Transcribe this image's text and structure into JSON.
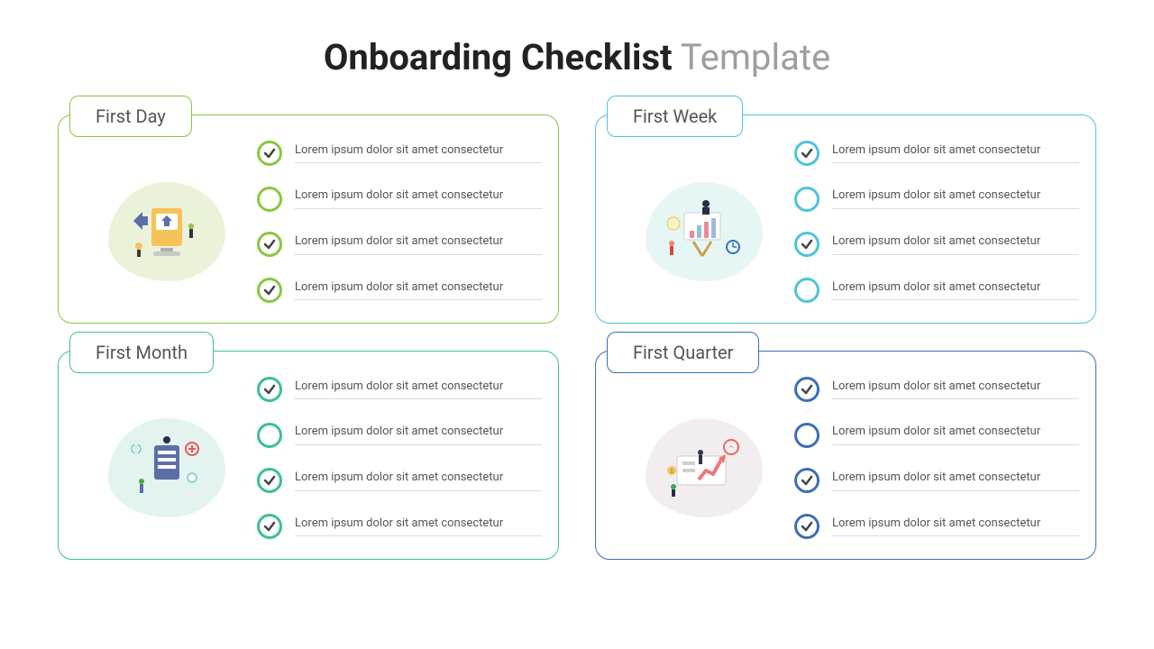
{
  "title_bold": "Onboarding Checklist",
  "title_light": " Template",
  "item_text": "Lorem ipsum dolor sit amet consectetur",
  "cards": [
    {
      "label": "First Day",
      "theme": "c-green",
      "items": [
        {
          "checked": true
        },
        {
          "checked": false
        },
        {
          "checked": true
        },
        {
          "checked": true
        }
      ]
    },
    {
      "label": "First Week",
      "theme": "c-cyan",
      "items": [
        {
          "checked": true
        },
        {
          "checked": false
        },
        {
          "checked": true
        },
        {
          "checked": false
        }
      ]
    },
    {
      "label": "First Month",
      "theme": "c-teal",
      "items": [
        {
          "checked": true
        },
        {
          "checked": false
        },
        {
          "checked": true
        },
        {
          "checked": true
        }
      ]
    },
    {
      "label": "First Quarter",
      "theme": "c-navy",
      "items": [
        {
          "checked": true
        },
        {
          "checked": false
        },
        {
          "checked": true
        },
        {
          "checked": true
        }
      ]
    }
  ]
}
